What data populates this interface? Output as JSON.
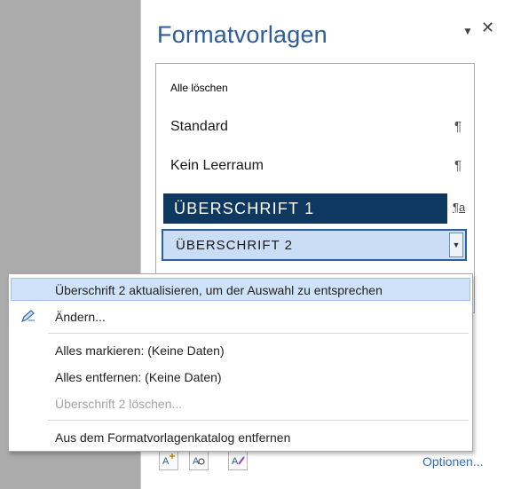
{
  "pane": {
    "title": "Formatvorlagen",
    "menu_icon": "▼",
    "close_icon": "✕",
    "clear_all": "Alle löschen",
    "styles": [
      {
        "label": "Standard",
        "mark": "¶"
      },
      {
        "label": "Kein Leerraum",
        "mark": "¶"
      }
    ],
    "heading1": {
      "label": "ÜBERSCHRIFT 1",
      "mark": "¶a"
    },
    "heading2": {
      "label": "ÜBERSCHRIFT 2",
      "dropdown_icon": "▼"
    },
    "bottom_icons": [
      "new-style-icon",
      "style-inspector-icon",
      "manage-styles-icon"
    ],
    "options_link": "Optionen..."
  },
  "context_menu": {
    "items": [
      {
        "label": "Überschrift 2 aktualisieren, um der Auswahl zu entsprechen",
        "state": "highlighted"
      },
      {
        "label": "Ändern...",
        "icon": "edit-pen-icon"
      },
      {
        "label": "Alles markieren: (Keine Daten)"
      },
      {
        "label": "Alles entfernen: (Keine Daten)"
      },
      {
        "label": "Überschrift 2 löschen...",
        "state": "disabled"
      },
      {
        "label": "Aus dem Formatvorlagenkatalog entfernen"
      }
    ]
  },
  "colors": {
    "accent_title": "#2e5e9a",
    "heading1_bg": "#0f3861",
    "heading2_bg": "#c9def5",
    "highlight": "#cfe3f8",
    "link": "#2e6db4"
  }
}
